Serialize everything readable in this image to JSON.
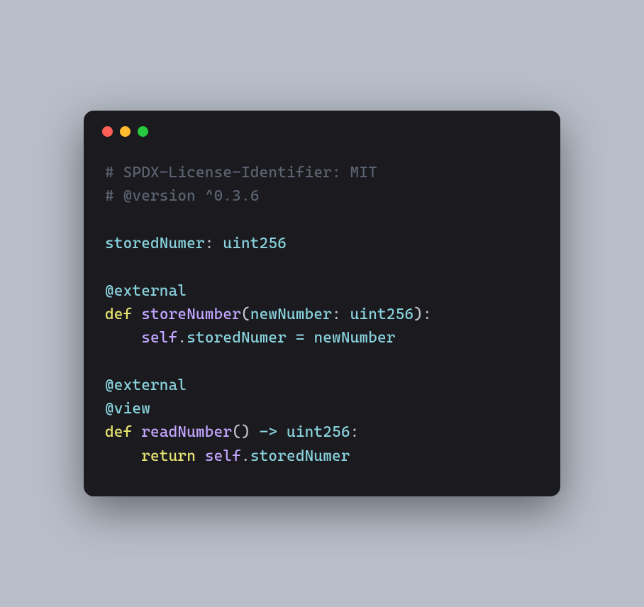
{
  "code": {
    "comment1": "# SPDX-License-Identifier: MIT",
    "comment2": "# @version ^0.3.6",
    "field_name": "storedNumer",
    "type_uint": "uint256",
    "deco_external1": "@external",
    "kw_def1": "def",
    "func_store": "storeNumber",
    "param_newnum": "newNumber",
    "self1": "self",
    "attr_stored1": "storedNumer",
    "eq": "=",
    "rhs_newnum": "newNumber",
    "deco_external2": "@external",
    "deco_view": "@view",
    "kw_def2": "def",
    "func_read": "readNumber",
    "arrow": "->",
    "kw_return": "return",
    "self2": "self",
    "attr_stored2": "storedNumer"
  }
}
